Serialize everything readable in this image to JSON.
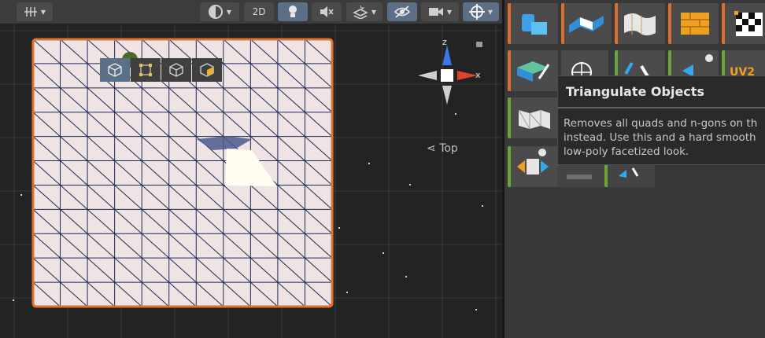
{
  "toolbar": {
    "mode_2d_label": "2D",
    "buttons": [
      "grid-snap-icon",
      "shading-mode-icon",
      "lighting-icon",
      "audio-mute-icon",
      "fx-icon",
      "visibility-icon",
      "camera-icon",
      "gizmos-icon"
    ]
  },
  "scene": {
    "gizmo_axes": {
      "z": "z",
      "x": "x"
    },
    "view_label": "Top",
    "view_modes": [
      "object-mode-icon",
      "vertex-mode-icon",
      "edge-mode-icon",
      "face-mode-icon"
    ],
    "colors": {
      "selection_outline": "#e0742f",
      "mesh_fill": "#efe3e3",
      "wire": "#1c2a5a",
      "z_axis": "#3a78e8",
      "x_axis": "#e0442c"
    }
  },
  "panel": {
    "tooltip": {
      "title": "Triangulate Objects",
      "description": "Removes all quads and n-gons on th\ninstead.  Use this and a hard smooth\nlow-poly facetized look."
    },
    "tool_icons": [
      "shapes-icon",
      "extrude-icon",
      "bend-icon",
      "bricks-icon",
      "checker-uv-icon",
      "paint-mesh-icon",
      "world-icon",
      "pivot-icon",
      "settings-arrows-icon",
      "uv2-icon",
      "triangulate-icon",
      "flip-normals-icon",
      "merge-icon",
      "mirror-icon"
    ]
  }
}
